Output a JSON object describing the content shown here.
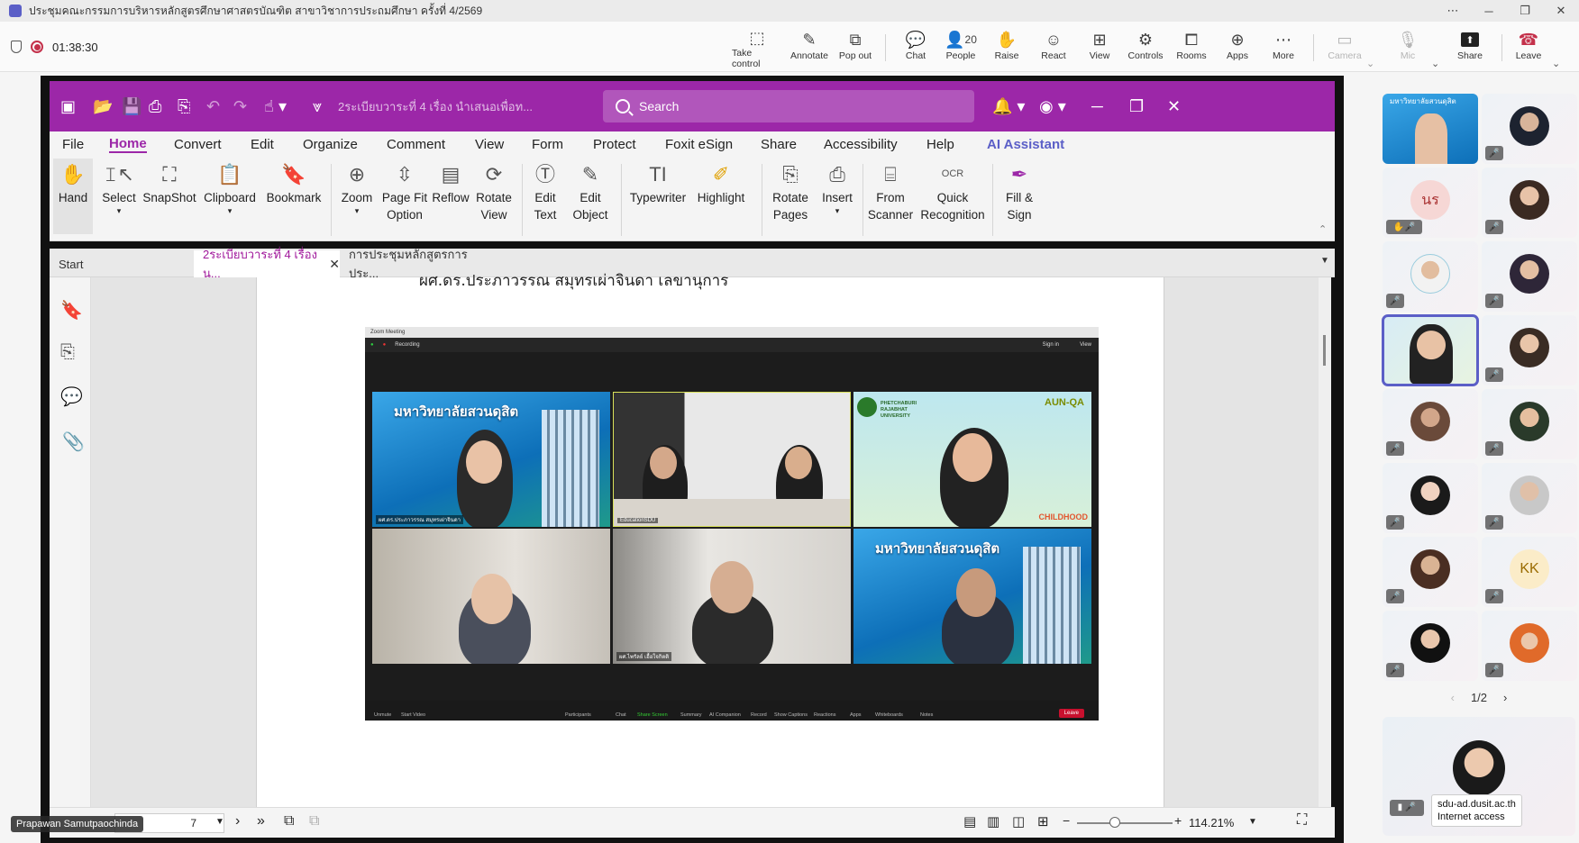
{
  "teams": {
    "window_title": "ประชุมคณะกรรมการบริหารหลักสูตรศึกษาศาสตรบัณฑิต สาขาวิชาการประถมศึกษา ครั้งที่ 4/2569",
    "timer": "01:38:30",
    "toolbar": {
      "take_control": "Take control",
      "annotate": "Annotate",
      "pop_out": "Pop out",
      "chat": "Chat",
      "people": "People",
      "people_count": "20",
      "raise": "Raise",
      "react": "React",
      "view": "View",
      "controls": "Controls",
      "rooms": "Rooms",
      "apps": "Apps",
      "more": "More",
      "camera": "Camera",
      "mic": "Mic",
      "share": "Share",
      "leave": "Leave"
    },
    "presenter_name": "Prapawan Samutpaochinda",
    "pager": "1/2",
    "self_tooltip": {
      "line1": "sdu-ad.dusit.ac.th",
      "line2": "Internet access"
    },
    "participants": [
      {
        "initials": ""
      },
      {
        "initials": ""
      },
      {
        "initials": "นร"
      },
      {
        "initials": ""
      },
      {
        "initials": ""
      },
      {
        "initials": ""
      },
      {
        "initials": ""
      },
      {
        "initials": ""
      },
      {
        "initials": ""
      },
      {
        "initials": ""
      },
      {
        "initials": ""
      },
      {
        "initials": ""
      },
      {
        "initials": ""
      },
      {
        "initials": "KK"
      },
      {
        "initials": ""
      },
      {
        "initials": ""
      }
    ],
    "colors": {
      "accent": "#5b5fc7",
      "leave": "#c4314b"
    }
  },
  "foxit": {
    "doc_title": "2ระเบียบวาระที่ 4 เรื่อง นำเสนอเพื่อท...",
    "search_placeholder": "Search",
    "menu": [
      "File",
      "Home",
      "Convert",
      "Edit",
      "Organize",
      "Comment",
      "View",
      "Form",
      "Protect",
      "Foxit eSign",
      "Share",
      "Accessibility",
      "Help",
      "AI Assistant"
    ],
    "ribbon": {
      "hand": "Hand",
      "select": "Select",
      "snapshot": "SnapShot",
      "clipboard": "Clipboard",
      "bookmark": "Bookmark",
      "zoom": "Zoom",
      "page_fit_1": "Page Fit",
      "page_fit_2": "Option",
      "reflow": "Reflow",
      "rotate_view_1": "Rotate",
      "rotate_view_2": "View",
      "edit_text_1": "Edit",
      "edit_text_2": "Text",
      "edit_object_1": "Edit",
      "edit_object_2": "Object",
      "typewriter": "Typewriter",
      "highlight": "Highlight",
      "rotate_pages_1": "Rotate",
      "rotate_pages_2": "Pages",
      "insert": "Insert",
      "from_scanner_1": "From",
      "from_scanner_2": "Scanner",
      "quick_recognition_1": "Quick",
      "quick_recognition_2": "Recognition",
      "fill_sign_1": "Fill &",
      "fill_sign_2": "Sign"
    },
    "tabs": {
      "start": "Start",
      "tab1": "2ระเบียบวาระที่ 4 เรื่อง น...",
      "tab2": "การประชุมหลักสูตรการประ..."
    },
    "doc_text_line": "ผศ.ดร.ประภาวรรณ สมุทรเผ่าจินดา เลขานุการ",
    "zoom_level": "114.21%",
    "page_input": "7",
    "colors": {
      "brand": "#9c27a8",
      "active_tab": "#a0189b"
    }
  },
  "zoom_screenshot": {
    "window_title": "Zoom Meeting",
    "recording": "Recording",
    "sign_in": "Sign in",
    "view": "View",
    "banner_text": "มหาวิทยาลัยสวนดุสิต",
    "pbru_text": "PHETCHABURI RAJABHAT UNIVERSITY",
    "aun_qa": "AUN-QA",
    "childhood": "CHILDHOOD",
    "tile_names": [
      "ผศ.ดร.ประภาวรรณ สมุทรเผ่าจินดา",
      "EducationSDU",
      "",
      "",
      "ผศ.ไพรัลย์ เอื้อใจกิตติ",
      ""
    ],
    "bar_items": [
      "Unmute",
      "Start Video",
      "Participants",
      "Chat",
      "Share Screen",
      "Summary",
      "AI Companion",
      "Record",
      "Show Captions",
      "Reactions",
      "Apps",
      "Whiteboards",
      "Notes"
    ],
    "leave": "Leave"
  }
}
